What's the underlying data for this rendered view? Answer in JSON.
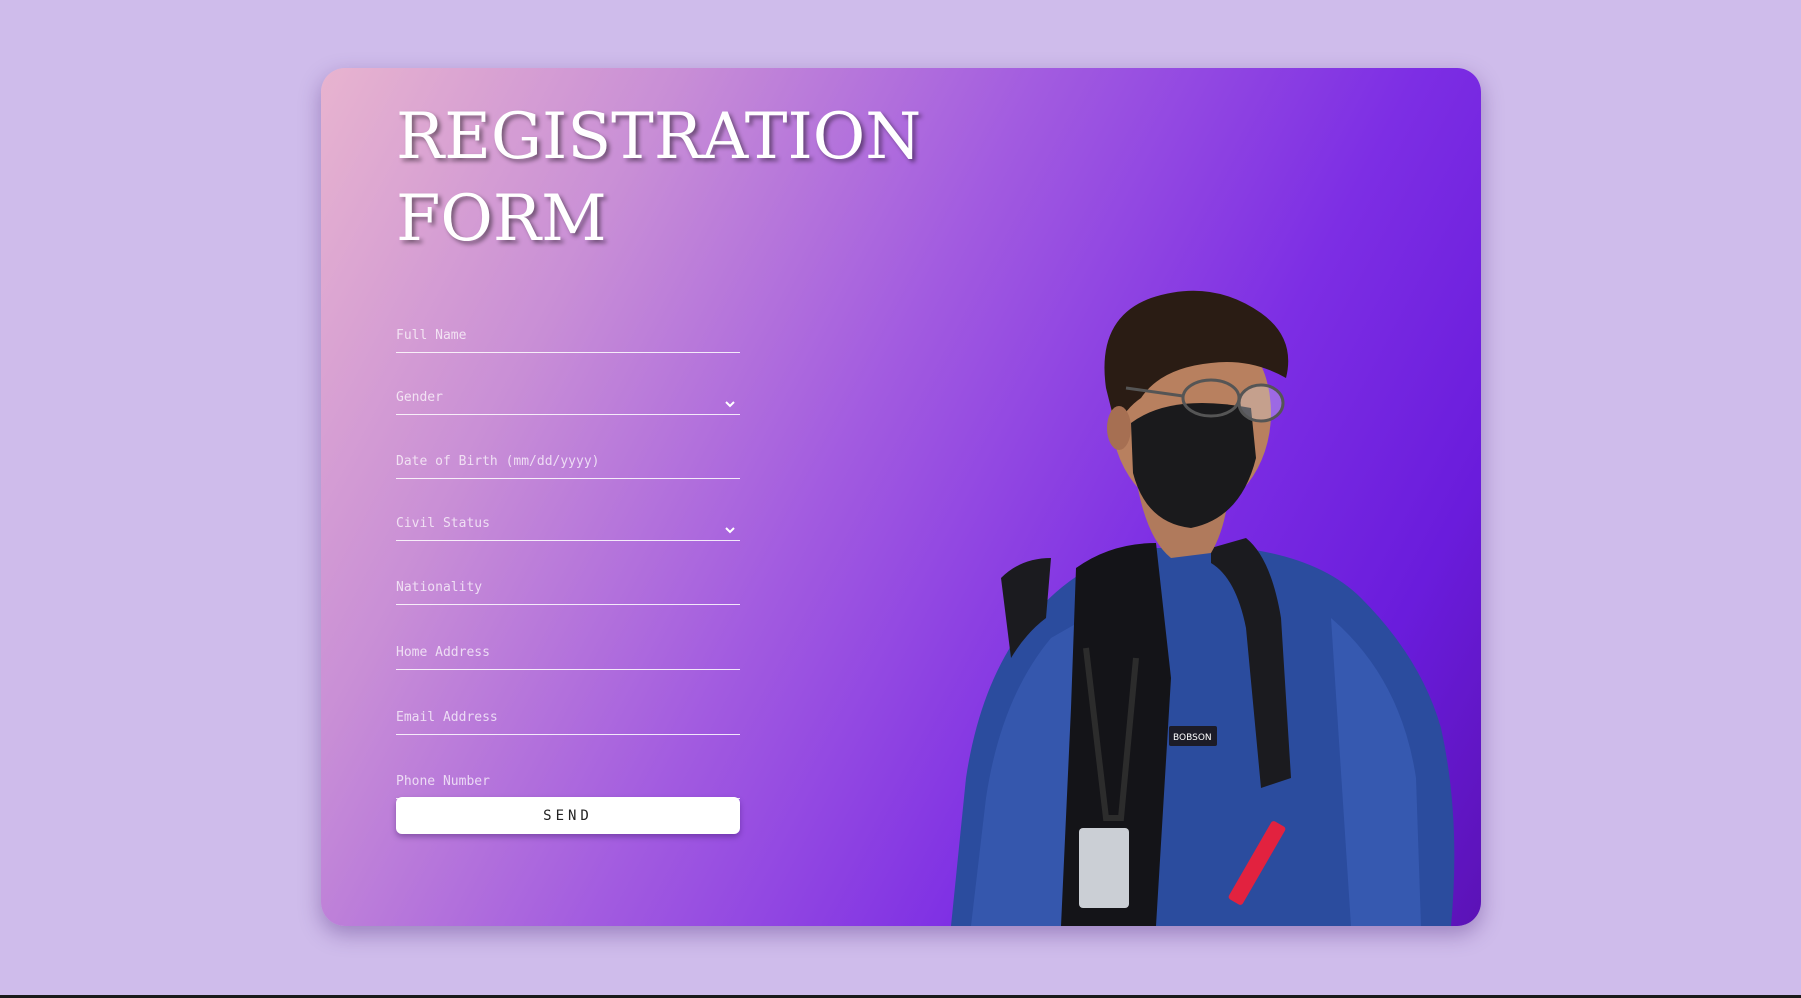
{
  "form": {
    "title_line1": "REGISTRATION",
    "title_line2": "FORM",
    "fields": [
      {
        "placeholder": "Full Name",
        "type": "text"
      },
      {
        "placeholder": "Gender",
        "type": "select"
      },
      {
        "placeholder": "Date of Birth (mm/dd/yyyy)",
        "type": "text"
      },
      {
        "placeholder": "Civil Status",
        "type": "select"
      },
      {
        "placeholder": "Nationality",
        "type": "text"
      },
      {
        "placeholder": "Home Address",
        "type": "text"
      },
      {
        "placeholder": "Email Address",
        "type": "text"
      },
      {
        "placeholder": "Phone Number",
        "type": "text"
      }
    ],
    "send_label": "SEND"
  },
  "photo": {
    "jacket_patch_text": "BOBSON",
    "tag_text": "BOBSON"
  },
  "colors": {
    "page_background": "#cfbceb",
    "gradient_start": "#e8b4cf",
    "gradient_mid": "#a25be0",
    "gradient_end": "#5b12b6",
    "jacket": "#2a4a9a",
    "button": "#ffffff"
  }
}
